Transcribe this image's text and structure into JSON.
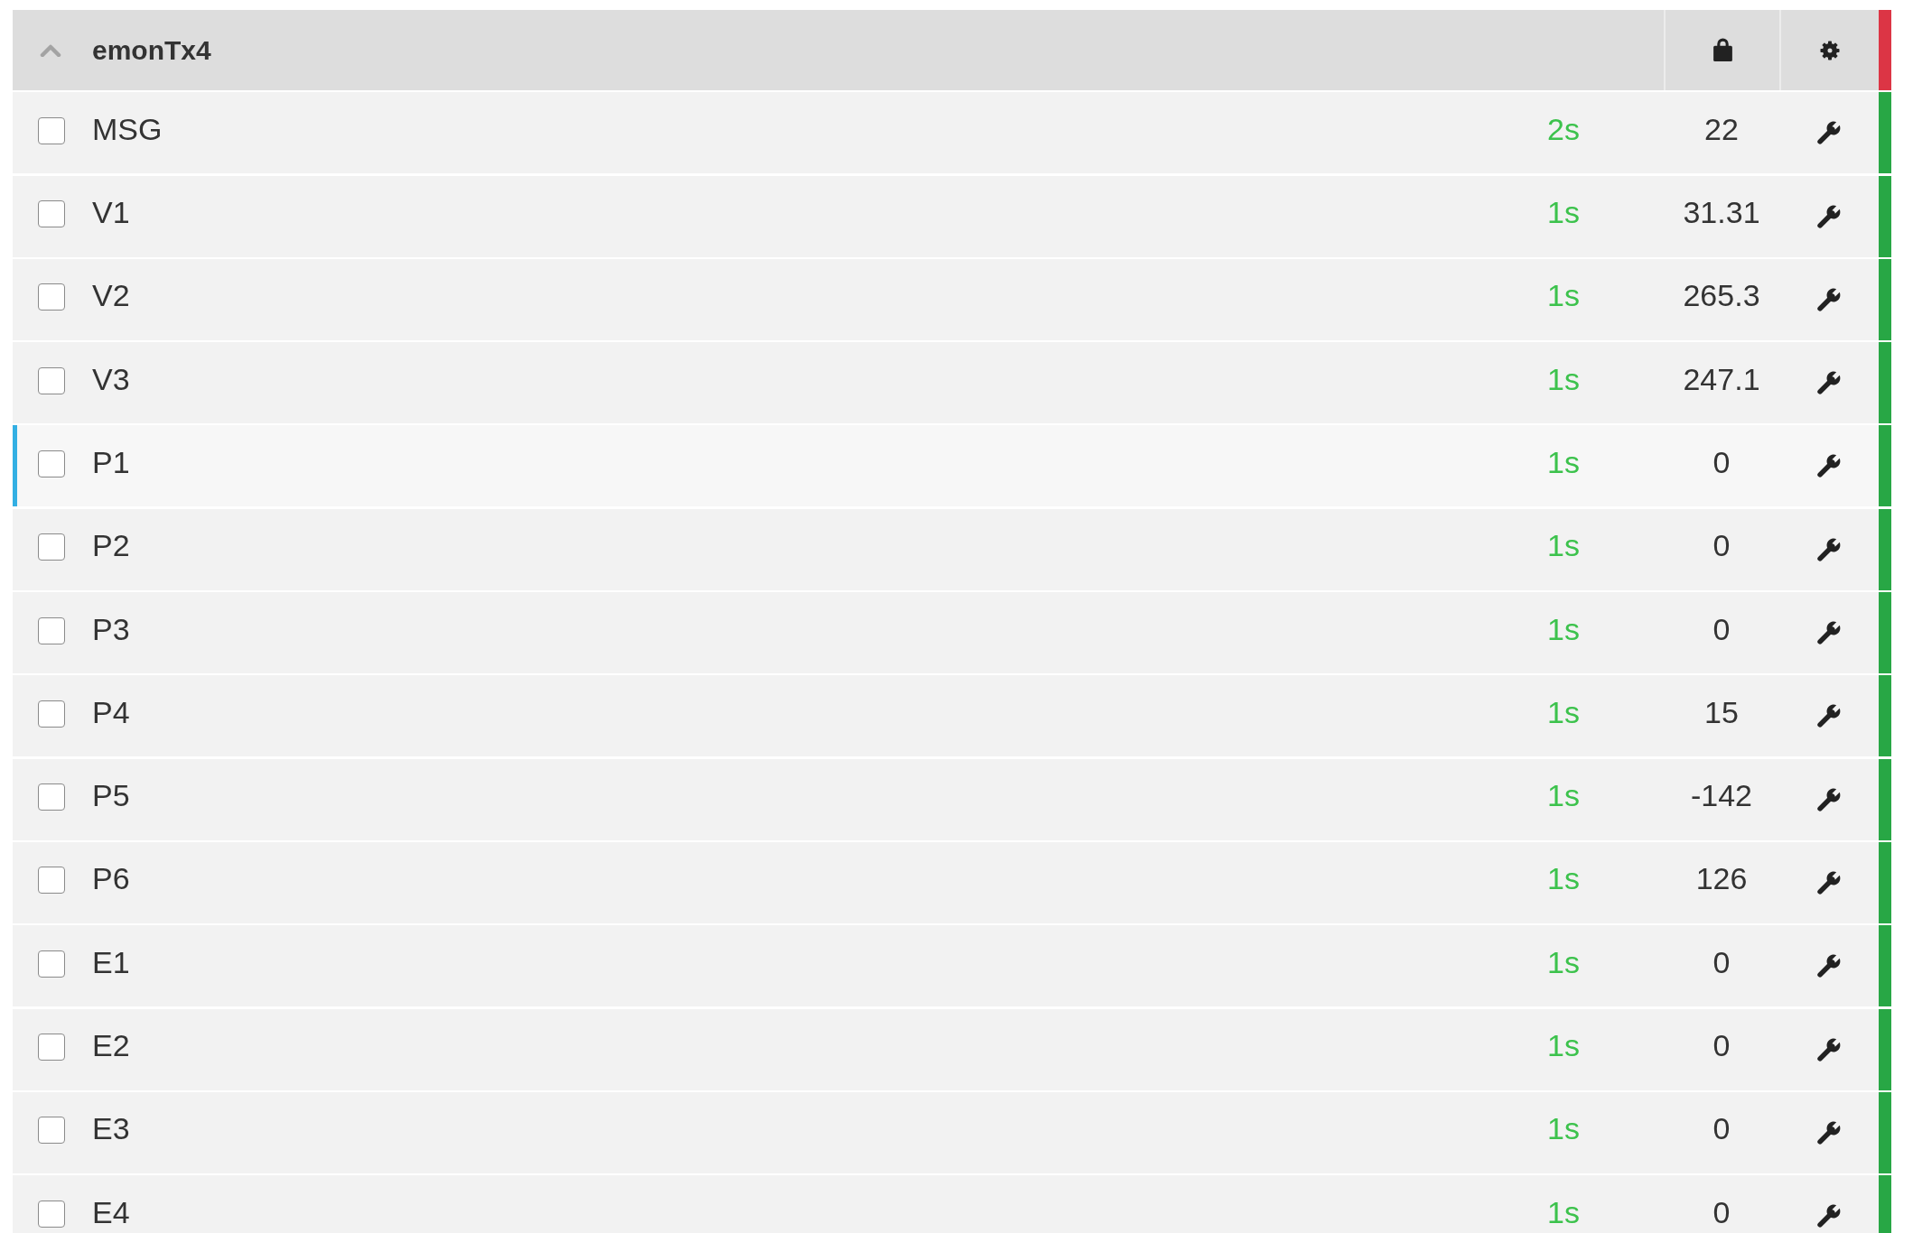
{
  "device": {
    "name": "emonTx4",
    "expanded": true,
    "color": "#dc3545"
  },
  "rows": [
    {
      "name": "MSG",
      "checked": false,
      "selected": false,
      "updated": "2s",
      "value": "22",
      "color": "#28a745"
    },
    {
      "name": "V1",
      "checked": false,
      "selected": false,
      "updated": "1s",
      "value": "31.31",
      "color": "#28a745"
    },
    {
      "name": "V2",
      "checked": false,
      "selected": false,
      "updated": "1s",
      "value": "265.3",
      "color": "#28a745"
    },
    {
      "name": "V3",
      "checked": false,
      "selected": false,
      "updated": "1s",
      "value": "247.1",
      "color": "#28a745"
    },
    {
      "name": "P1",
      "checked": false,
      "selected": true,
      "updated": "1s",
      "value": "0",
      "color": "#28a745"
    },
    {
      "name": "P2",
      "checked": false,
      "selected": false,
      "updated": "1s",
      "value": "0",
      "color": "#28a745"
    },
    {
      "name": "P3",
      "checked": false,
      "selected": false,
      "updated": "1s",
      "value": "0",
      "color": "#28a745"
    },
    {
      "name": "P4",
      "checked": false,
      "selected": false,
      "updated": "1s",
      "value": "15",
      "color": "#28a745"
    },
    {
      "name": "P5",
      "checked": false,
      "selected": false,
      "updated": "1s",
      "value": "-142",
      "color": "#28a745"
    },
    {
      "name": "P6",
      "checked": false,
      "selected": false,
      "updated": "1s",
      "value": "126",
      "color": "#28a745"
    },
    {
      "name": "E1",
      "checked": false,
      "selected": false,
      "updated": "1s",
      "value": "0",
      "color": "#28a745"
    },
    {
      "name": "E2",
      "checked": false,
      "selected": false,
      "updated": "1s",
      "value": "0",
      "color": "#28a745"
    },
    {
      "name": "E3",
      "checked": false,
      "selected": false,
      "updated": "1s",
      "value": "0",
      "color": "#28a745"
    },
    {
      "name": "E4",
      "checked": false,
      "selected": false,
      "updated": "1s",
      "value": "0",
      "color": "#28a745"
    }
  ]
}
